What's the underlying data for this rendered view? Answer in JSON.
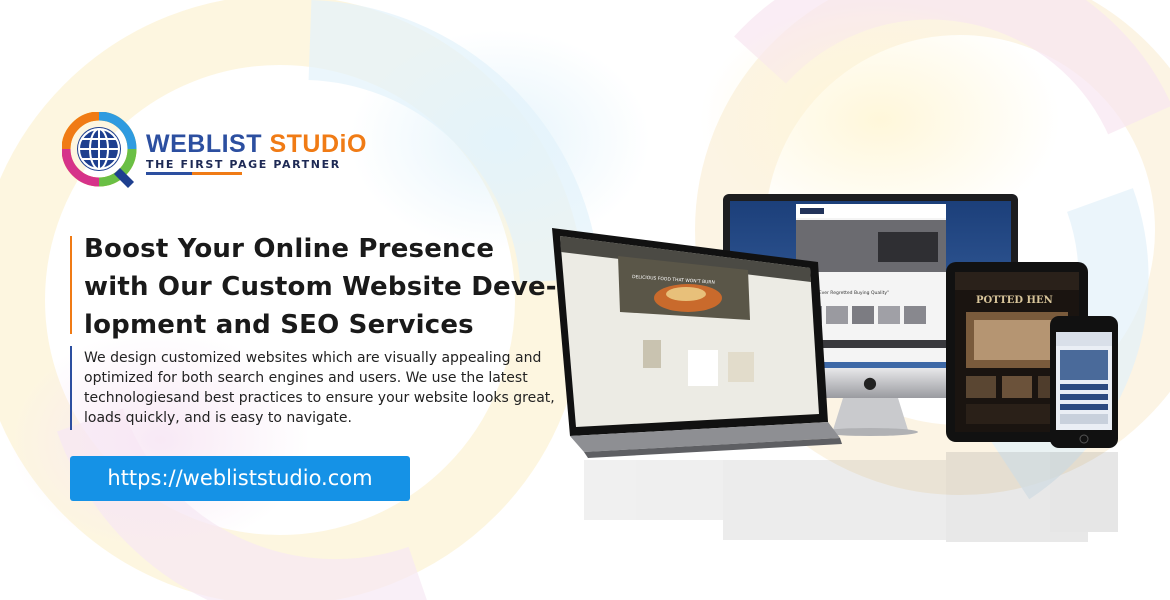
{
  "brand": {
    "name_part1": "WEBLIST",
    "name_part2": "STUDiO",
    "tagline": "THE FIRST PAGE PARTNER"
  },
  "hero": {
    "headline": "Boost Your Online Presence with Our Custom Website Deve-lopment and SEO Services",
    "body": "We design customized websites which are visually appealing and optimized for both search engines and users. We use the latest technologiesand best practices to ensure your website looks great, loads quickly, and is easy to navigate.",
    "url_button": "https://webliststudio.com"
  },
  "devices": {
    "monitor_tagline": "\"Nobody Ever Regretted Buying Quality\"",
    "tablet_title": "POTTED HEN",
    "laptop_banner": "DELICIOUS FOOD THAT WON'T BURN A HOLE IN YOUR WALLET"
  },
  "colors": {
    "brand_blue": "#2c4fa0",
    "brand_orange": "#f07b15",
    "button_blue": "#1592e6"
  }
}
